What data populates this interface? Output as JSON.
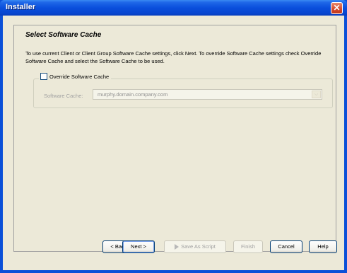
{
  "window": {
    "title": "Installer"
  },
  "page": {
    "title": "Select Software Cache",
    "description": "To use current Client or Client Group Software Cache settings, click Next. To override Software Cache settings check Override Software Cache and select the Software Cache to be used."
  },
  "override": {
    "checkbox_label": "Override Software Cache",
    "checked": false,
    "field_label": "Software Cache:",
    "selected_value": "murphy.domain.company.com"
  },
  "buttons": {
    "back": "< Back",
    "next": "Next >",
    "save_script": "Save As Script",
    "finish": "Finish",
    "cancel": "Cancel",
    "help": "Help"
  }
}
